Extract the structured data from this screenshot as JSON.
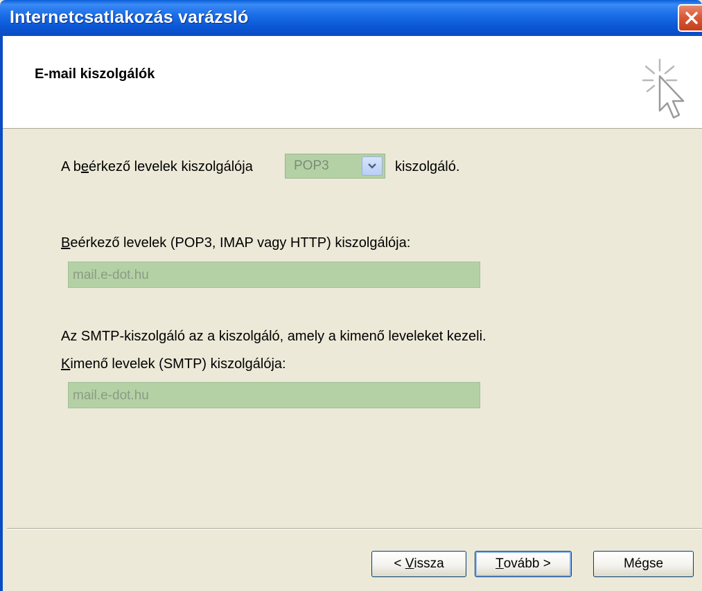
{
  "window": {
    "title": "Internetcsatlakozás varázsló"
  },
  "header": {
    "title": "E-mail kiszolgálók"
  },
  "body": {
    "incoming_type_prefix": "A ",
    "incoming_type_accel": "e",
    "incoming_type_pre_accel": "b",
    "incoming_type_rest": "érkező levelek kiszolgálója",
    "incoming_type_suffix": "kiszolgáló.",
    "server_type_value": "POP3",
    "incoming_server_label_accel": "B",
    "incoming_server_label_rest": "eérkező levelek (POP3, IMAP vagy HTTP) kiszolgálója:",
    "incoming_server_value": "mail.e-dot.hu",
    "smtp_info": "Az SMTP-kiszolgáló az a kiszolgáló, amely a kimenő leveleket kezeli.",
    "outgoing_server_label_accel": "K",
    "outgoing_server_label_rest": "imenő levelek (SMTP) kiszolgálója:",
    "outgoing_server_value": "mail.e-dot.hu"
  },
  "buttons": {
    "back_prefix": "< ",
    "back_accel": "V",
    "back_rest": "issza",
    "next_accel": "T",
    "next_rest": "ovább >",
    "cancel": "Mégse"
  },
  "colors": {
    "titlebar": "#0a56d4",
    "field_bg": "#b4d1a6",
    "dialog_bg": "#ece9d8"
  },
  "icons": {
    "close": "close-icon",
    "wizard": "wizard-cursor-icon",
    "dropdown": "chevron-down-icon"
  }
}
